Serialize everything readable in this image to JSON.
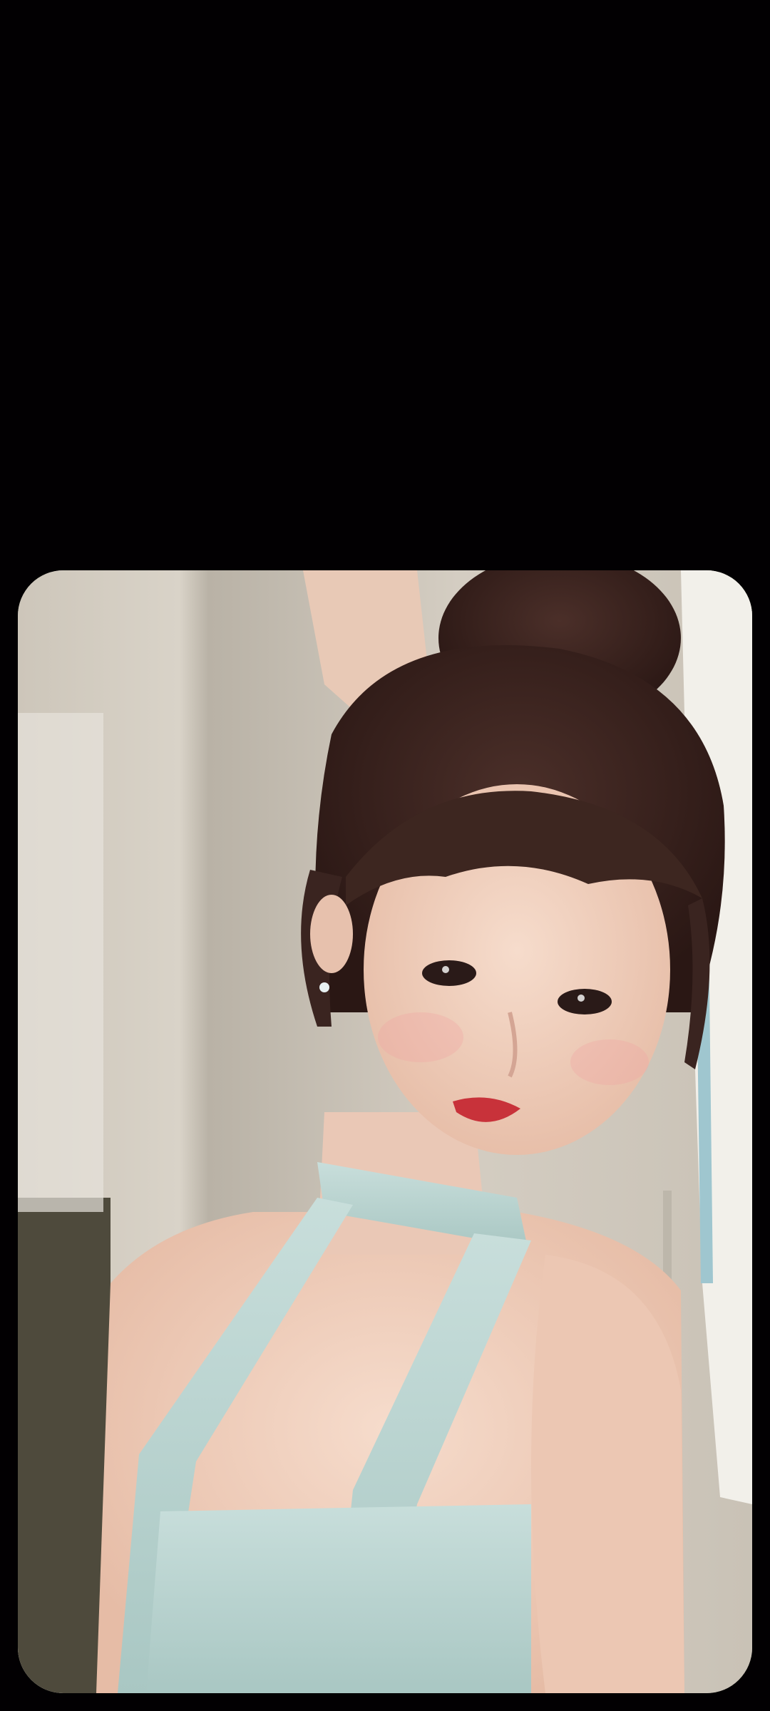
{
  "screen": {
    "background": "#020002"
  },
  "photo": {
    "kind": "fullscreen-photo-preview",
    "colors": {
      "wall": "#d6cfc3",
      "wall_shadow": "#a8a196",
      "floor_dark": "#4a4636",
      "hair": "#3a2420",
      "skin": "#f1d3c2",
      "top": "#bcd6d2",
      "shirt_white": "#f3f1ec",
      "lips": "#c8323a"
    }
  }
}
